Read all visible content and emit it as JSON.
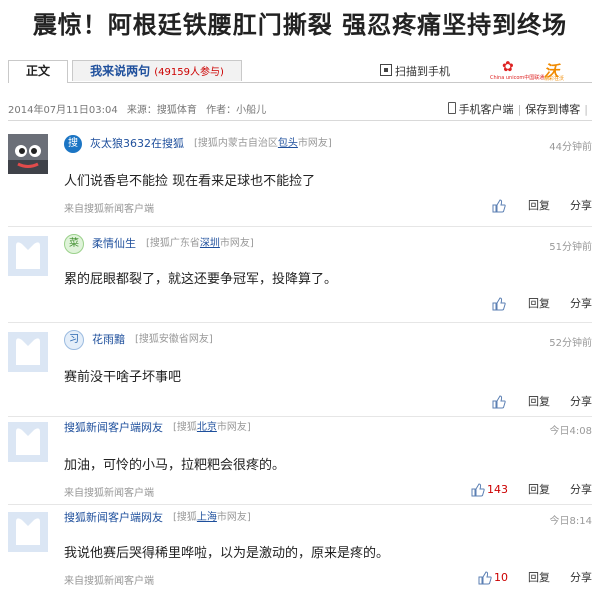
{
  "headline": "震惊！阿根廷铁腰肛门撕裂 强忍疼痛坚持到终场",
  "tabs": {
    "main_label": "正文",
    "comments_label": "我来说两句",
    "comments_count": "(49159",
    "comments_suffix": "人参与)"
  },
  "toolbar": {
    "scan_label": "扫描到手机",
    "carrier_logo_text": "China unicom中国联通",
    "wo_logo_text": "沃",
    "wo_sub": "精彩在沃"
  },
  "meta": {
    "datetime": "2014年07月11日03:04",
    "source": "来源：搜狐体育",
    "author": "作者：小船儿",
    "client_link": "手机客户端",
    "save_link": "保存到博客"
  },
  "comment_actions": {
    "reply": "回复",
    "share": "分享"
  },
  "comments": [
    {
      "name": "灰太狼3632在搜狐",
      "badge": "搜",
      "loc_prefix": "[搜狐内蒙古自治区",
      "loc_city": "包头",
      "loc_suffix": "市网友]",
      "time": "44分钟前",
      "text": "人们说香皂不能捡 现在看来足球也不能捡了",
      "source": "来自搜狐新闻客户端",
      "likes": ""
    },
    {
      "name": "柔情仙生",
      "badge": "菜",
      "loc_prefix": "[搜狐广东省",
      "loc_city": "深圳",
      "loc_suffix": "市网友]",
      "time": "51分钟前",
      "text": "累的屁眼都裂了，就这还要争冠军，投降算了。",
      "source": "",
      "likes": ""
    },
    {
      "name": "花雨黯",
      "badge": "习",
      "loc_prefix": "[搜狐安徽省网友]",
      "loc_city": "",
      "loc_suffix": "",
      "time": "52分钟前",
      "text": "赛前没干啥子坏事吧",
      "source": "",
      "likes": ""
    },
    {
      "name": "搜狐新闻客户端网友",
      "badge": "",
      "loc_prefix": "[搜狐",
      "loc_city": "北京",
      "loc_suffix": "市网友]",
      "time": "今日4:08",
      "text": "加油，可怜的小马，拉粑粑会很疼的。",
      "source": "来自搜狐新闻客户端",
      "likes": "143"
    },
    {
      "name": "搜狐新闻客户端网友",
      "badge": "",
      "loc_prefix": "[搜狐",
      "loc_city": "上海",
      "loc_suffix": "市网友]",
      "time": "今日8:14",
      "text": "我说他赛后哭得稀里哗啦，以为是激动的，原来是疼的。",
      "source": "来自搜狐新闻客户端",
      "likes": "10"
    }
  ],
  "colors": {
    "link_blue": "#1e4f9c",
    "like_red": "#cc0000",
    "muted": "#999999"
  }
}
